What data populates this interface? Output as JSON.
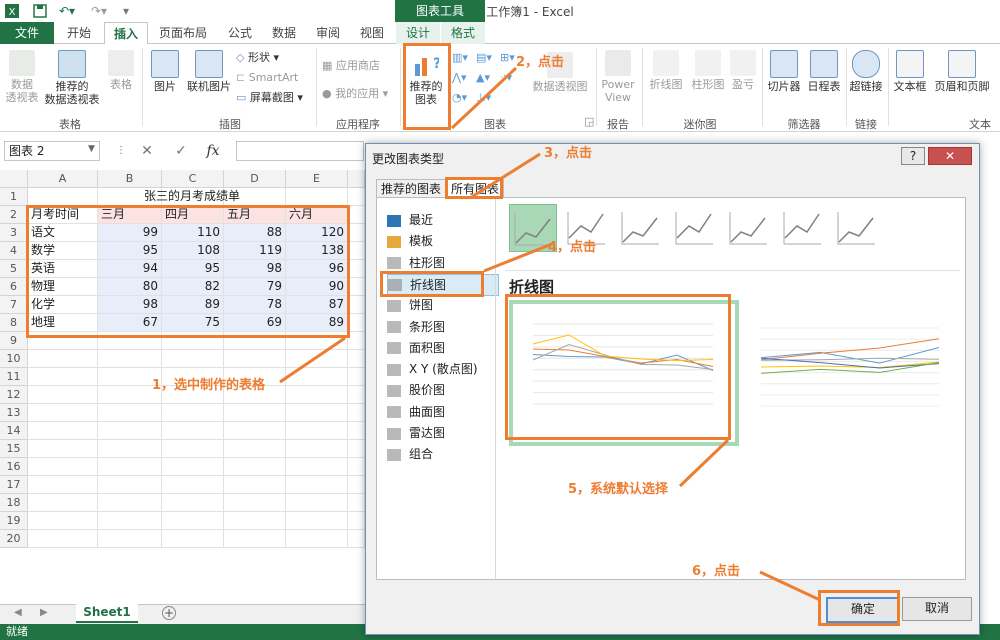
{
  "window": {
    "title": "工作簿1 - Excel",
    "context_tab_group": "图表工具"
  },
  "tabs": [
    "文件",
    "开始",
    "插入",
    "页面布局",
    "公式",
    "数据",
    "审阅",
    "视图",
    "设计",
    "格式"
  ],
  "ribbon": {
    "pivot": "数据\n透视表",
    "rec_pivot": "推荐的\n数据透视表",
    "table": "表格",
    "group_table": "表格",
    "picture": "图片",
    "online_picture": "联机图片",
    "shapes": "形状 ▾",
    "smartart": "SmartArt",
    "screenshot": "屏幕截图 ▾",
    "group_illustrations": "插图",
    "app_store": "应用商店",
    "my_apps": "我的应用 ▾",
    "group_apps": "应用程序",
    "rec_charts": "推荐的\n图表",
    "pivot_chart": "数据透视图",
    "group_charts": "图表",
    "powerview": "Power\nView",
    "group_reports": "报告",
    "sl_line": "折线图",
    "sl_column": "柱形图",
    "sl_winloss": "盈亏",
    "group_sparklines": "迷你图",
    "slicer": "切片器",
    "timeline": "日程表",
    "group_filters": "筛选器",
    "hyperlink": "超链接",
    "group_links": "链接",
    "textbox": "文本框",
    "header_footer": "页眉和页脚",
    "group_text": "文本"
  },
  "formula_bar": {
    "name_box": "图表 2",
    "cancel": "✕",
    "enter": "✓",
    "fx": "fx"
  },
  "sheet": {
    "columns": [
      "A",
      "B",
      "C",
      "D",
      "E"
    ],
    "rows": [
      "1",
      "2",
      "3",
      "4",
      "5",
      "6",
      "7",
      "8",
      "9",
      "10",
      "11",
      "12",
      "13",
      "14",
      "15",
      "16",
      "17",
      "18",
      "19",
      "20"
    ],
    "title": "张三的月考成绩单",
    "header": [
      "月考时间",
      "三月",
      "四月",
      "五月",
      "六月"
    ],
    "data": [
      [
        "语文",
        "99",
        "110",
        "88",
        "120"
      ],
      [
        "数学",
        "95",
        "108",
        "119",
        "138"
      ],
      [
        "英语",
        "94",
        "95",
        "98",
        "96"
      ],
      [
        "物理",
        "80",
        "82",
        "79",
        "90"
      ],
      [
        "化学",
        "98",
        "89",
        "78",
        "87"
      ],
      [
        "地理",
        "67",
        "75",
        "69",
        "89"
      ]
    ],
    "tab_name": "Sheet1"
  },
  "status": {
    "left": "就绪"
  },
  "dialog": {
    "title": "更改图表类型",
    "help": "?",
    "close": "✕",
    "tab_recommended": "推荐的图表",
    "tab_all": "所有图表",
    "categories": [
      "最近",
      "模板",
      "柱形图",
      "折线图",
      "饼图",
      "条形图",
      "面积图",
      "X Y (散点图)",
      "股价图",
      "曲面图",
      "雷达图",
      "组合"
    ],
    "section_title": "折线图",
    "ok": "确定",
    "cancel": "取消"
  },
  "annotations": {
    "a1": "1，选中制作的表格",
    "a2": "2，点击",
    "a3": "3，点击",
    "a4": "4，点击",
    "a5": "5，系统默认选择",
    "a6": "6，点击"
  },
  "colors": {
    "excel_green": "#217346",
    "annotation": "#ed7d31"
  }
}
